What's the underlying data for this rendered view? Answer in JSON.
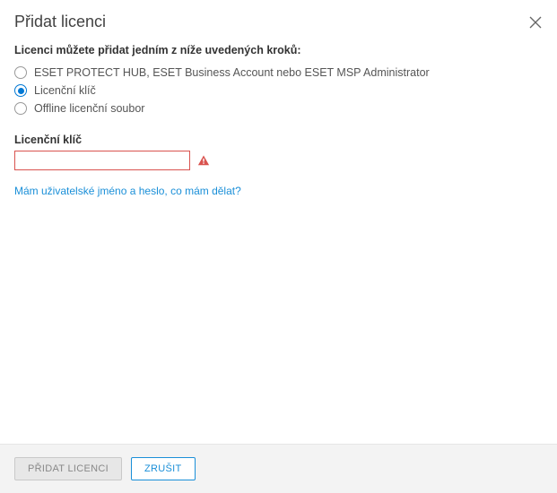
{
  "header": {
    "title": "Přidat licenci"
  },
  "intro": "Licenci můžete přidat jedním z níže uvedených kroků:",
  "options": [
    {
      "label": "ESET PROTECT HUB, ESET Business Account nebo ESET MSP Administrator",
      "selected": false
    },
    {
      "label": "Licenční klíč",
      "selected": true
    },
    {
      "label": "Offline licenční soubor",
      "selected": false
    }
  ],
  "field": {
    "label": "Licenční klíč",
    "value": ""
  },
  "help_link": "Mám uživatelské jméno a heslo, co mám dělat?",
  "footer": {
    "primary": "PŘIDAT LICENCI",
    "secondary": "ZRUŠIT"
  }
}
